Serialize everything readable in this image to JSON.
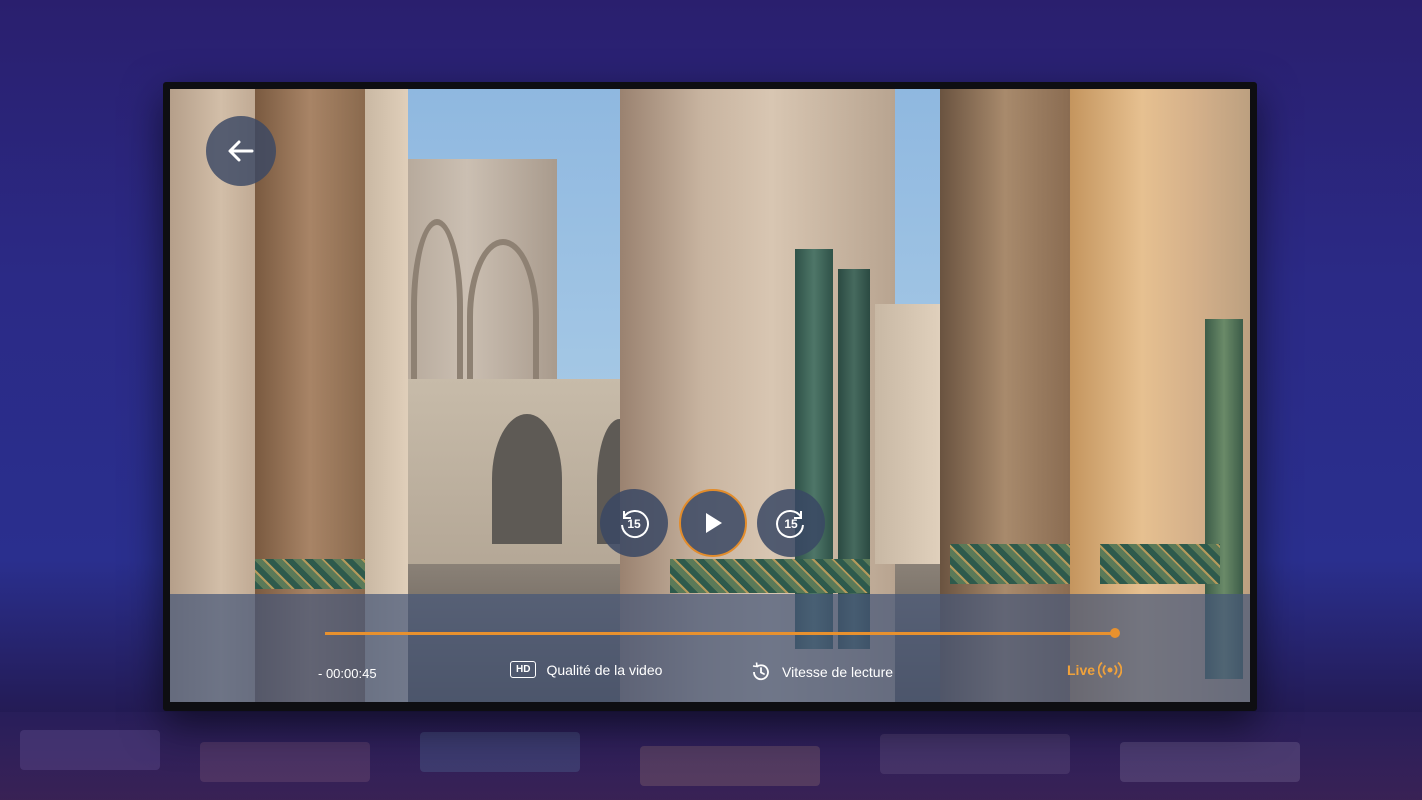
{
  "player": {
    "back_icon": "arrow-left-icon",
    "rewind_label": "15",
    "forward_label": "15",
    "play_icon": "play-icon",
    "time_remaining": "- 00:00:45",
    "progress": 0.998,
    "quality": {
      "badge": "HD",
      "label": "Qualité de la video"
    },
    "speed": {
      "icon": "clock-icon",
      "label": "Vitesse de lecture"
    },
    "live": {
      "label": "Live",
      "icon": "broadcast-icon"
    }
  },
  "colors": {
    "accent": "#e8912e",
    "control_bg": "#3a4864",
    "live": "#f0a23b"
  }
}
